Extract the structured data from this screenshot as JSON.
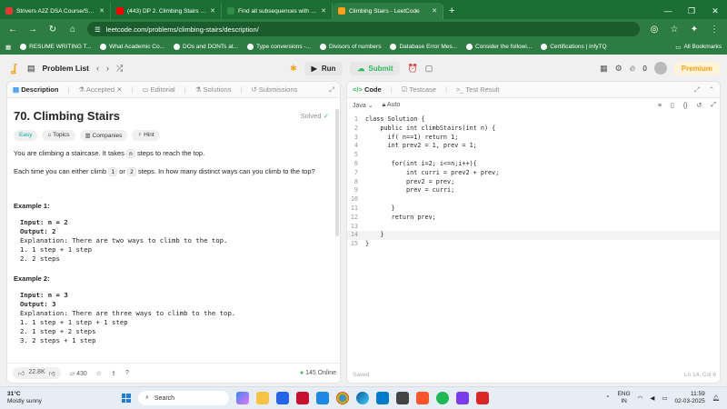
{
  "browser": {
    "tabs": [
      {
        "label": "Strivers A2Z DSA Course/Sheet",
        "color": "#e53935"
      },
      {
        "label": "(443) DP 2. Climbing Stairs | Lea",
        "color": "#ff0000"
      },
      {
        "label": "Find all subsequences with sum",
        "color": "#2f8d46"
      },
      {
        "label": "Climbing Stairs - LeetCode",
        "color": "#ffa116"
      }
    ],
    "url": "leetcode.com/problems/climbing-stairs/description/",
    "bookmarks": [
      "RESUME WRITING T...",
      "What Academic Co...",
      "DOs and DONTs at...",
      "Type conversions -...",
      "Divisors of numbers",
      "Database Error Mes...",
      "Consider the followi...",
      "Certifications | InfyTQ"
    ],
    "all_bookmarks": "All Bookmarks"
  },
  "lc_nav": {
    "problem_list": "Problem List",
    "run": "Run",
    "submit": "Submit",
    "coins": "0",
    "premium": "Premium"
  },
  "left_tabs": [
    "Description",
    "Accepted",
    "Editorial",
    "Solutions",
    "Submissions"
  ],
  "problem": {
    "title": "70. Climbing Stairs",
    "solved": "Solved",
    "tags": [
      "Easy",
      "Topics",
      "Companies",
      "Hint"
    ],
    "desc1_a": "You are climbing a staircase. It takes ",
    "desc1_code": "n",
    "desc1_b": " steps to reach the top.",
    "desc2_a": "Each time you can either climb ",
    "desc2_c1": "1",
    "desc2_or": " or ",
    "desc2_c2": "2",
    "desc2_b": " steps. In how many distinct ways can you climb to the top?",
    "ex1_head": "Example 1:",
    "ex1_lines": [
      "Input: n = 2",
      "Output: 2",
      "Explanation: There are two ways to climb to the top.",
      "1. 1 step + 1 step",
      "2. 2 steps"
    ],
    "ex2_head": "Example 2:",
    "ex2_lines": [
      "Input: n = 3",
      "Output: 3",
      "Explanation: There are three ways to climb to the top.",
      "1. 1 step + 1 step + 1 step",
      "2. 1 step + 2 steps",
      "3. 2 steps + 1 step"
    ],
    "likes": "22.8K",
    "comments": "430",
    "online": "145 Online"
  },
  "right_tabs": [
    "Code",
    "Testcase",
    "Test Result"
  ],
  "editor": {
    "language": "Java",
    "mode": "Auto",
    "saved": "Saved",
    "position": "Ln 14, Col 6"
  },
  "code_lines": [
    "class Solution {",
    "    public int climbStairs(int n) {",
    "      if( n==1) return 1;",
    "      int prev2 = 1, prev = 1;",
    "",
    "       for(int i=2; i<=n;i++){",
    "           int curri = prev2 + prev;",
    "           prev2 = prev;",
    "           prev = curri;",
    "",
    "       }",
    "       return prev;",
    "",
    "    }",
    "}"
  ],
  "taskbar": {
    "temp": "31°C",
    "weather": "Mostly sunny",
    "search": "Search",
    "lang": "ENG",
    "region": "IN",
    "time": "11:59",
    "date": "02-03-2025"
  }
}
